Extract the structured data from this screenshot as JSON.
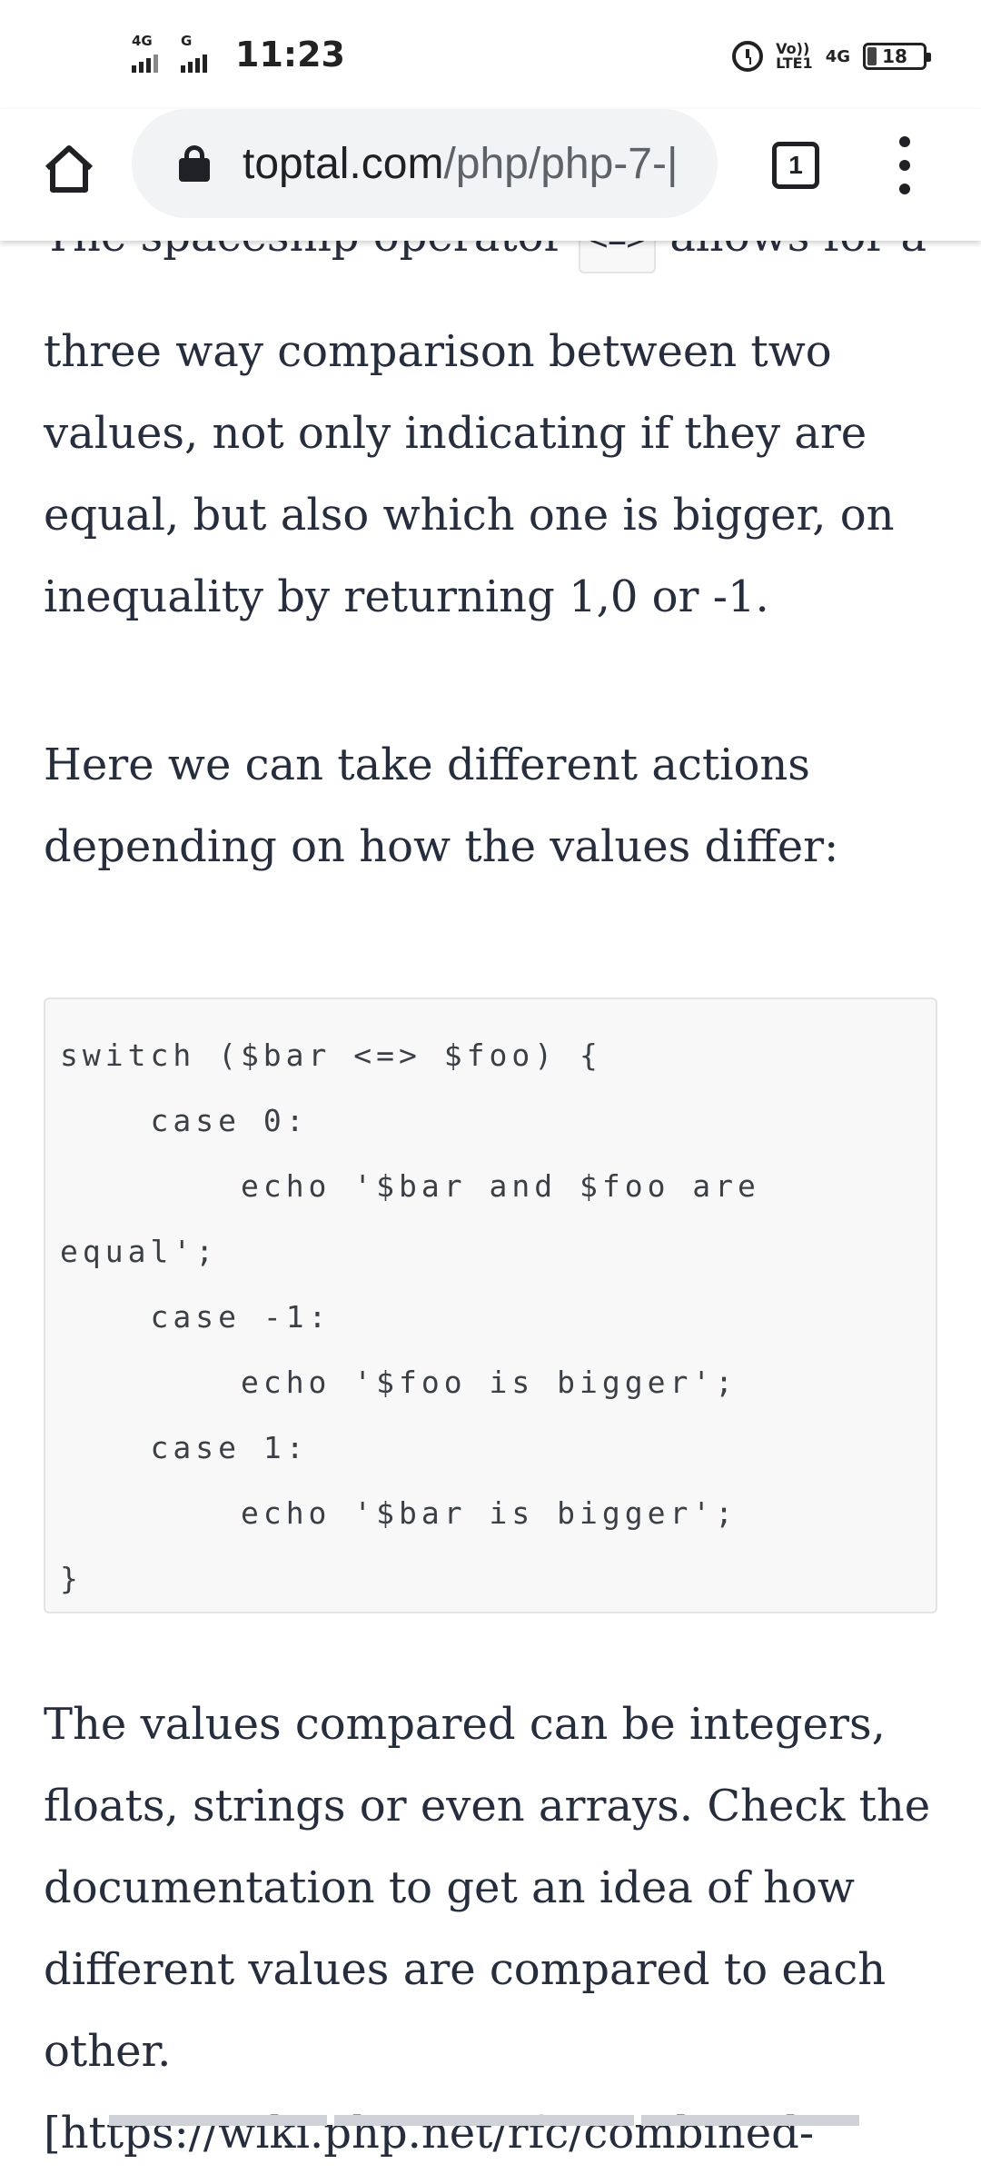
{
  "status_bar": {
    "sim1_label": "4G",
    "sim2_label": "G",
    "time": "11:23",
    "volte_top": "Vo))",
    "volte_bottom": "LTE1",
    "network": "4G",
    "battery": "18"
  },
  "browser": {
    "url_host": "toptal.com",
    "url_path": "/php/php-7-|",
    "tab_count": "1"
  },
  "article": {
    "partial_line_before": "The spaceship operator",
    "partial_inline_code": "<=>",
    "partial_line_after": "allows for a",
    "paragraph_1": "three way comparison between two values, not only indicating if they are equal, but also which one is bigger, on inequality by returning 1,0 or -1.",
    "paragraph_2": "Here we can take different actions depending on how the values differ:",
    "code_block": "switch ($bar <=> $foo) {\n    case 0:\n        echo '$bar and $foo are equal';\n    case -1:\n        echo '$foo is bigger';\n    case 1:\n        echo '$bar is bigger';\n}",
    "paragraph_3": "The values compared can be integers, floats, strings or even arrays. Check the documentation to get an idea of how different values are compared to each other. [https://wiki.php.net/rfc/combined-"
  }
}
